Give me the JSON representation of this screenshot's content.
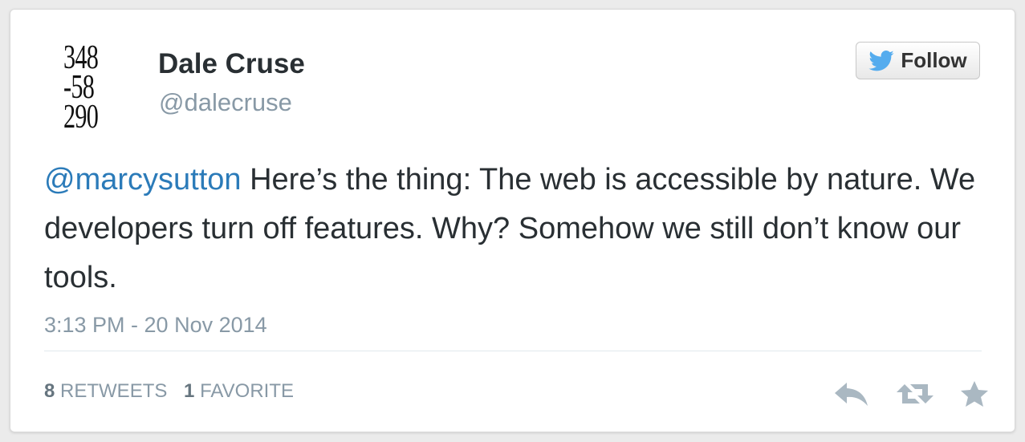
{
  "tweet": {
    "avatar_lines": [
      "348",
      "-58",
      "290"
    ],
    "author_name": "Dale Cruse",
    "author_handle": "@dalecruse",
    "follow_label": "Follow",
    "mention": "@marcysutton",
    "body": " Here’s the thing: The web is accessible by nature. We developers turn off features. Why? Somehow we still don’t know our tools.",
    "timestamp": "3:13 PM - 20 Nov 2014",
    "retweet_count": "8",
    "retweet_label": "RETWEETS",
    "favorite_count": "1",
    "favorite_label": "FAVORITE",
    "actions": {
      "reply_icon": "reply-icon",
      "retweet_icon": "retweet-icon",
      "favorite_icon": "star-icon"
    }
  },
  "colors": {
    "accent": "#2b7bb9",
    "muted": "#8899a6",
    "text": "#292f33",
    "bird": "#55acee",
    "icon": "#aab8c2"
  }
}
